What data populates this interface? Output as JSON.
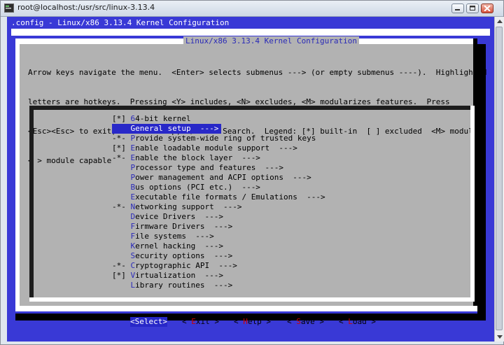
{
  "window": {
    "title": "root@localhost:/usr/src/linux-3.13.4",
    "buttons": [
      "minimize",
      "maximize",
      "close"
    ]
  },
  "terminal": {
    "config_title": ".config - Linux/x86 3.13.4 Kernel Configuration",
    "dialog_title": "Linux/x86 3.13.4 Kernel Configuration",
    "help_lines": [
      "Arrow keys navigate the menu.  <Enter> selects submenus ---> (or empty submenus ----).  Highlighted",
      "letters are hotkeys.  Pressing <Y> includes, <N> excludes, <M> modularizes features.  Press",
      "<Esc><Esc> to exit, <?> for Help, </> for Search.  Legend: [*] built-in  [ ] excluded  <M> module",
      "< > module capable"
    ],
    "menu": [
      {
        "prefix": "[*] ",
        "hotkey": "6",
        "rest": "4-bit kernel",
        "selected": false
      },
      {
        "prefix": "    ",
        "hotkey": "G",
        "rest": "eneral setup  --->",
        "selected": true
      },
      {
        "prefix": "-*- ",
        "hotkey": "P",
        "rest": "rovide system-wide ring of trusted keys",
        "selected": false
      },
      {
        "prefix": "[*] ",
        "hotkey": "E",
        "rest": "nable loadable module support  --->",
        "selected": false
      },
      {
        "prefix": "-*- ",
        "hotkey": "E",
        "rest": "nable the block layer  --->",
        "selected": false
      },
      {
        "prefix": "    ",
        "hotkey": "P",
        "rest": "rocessor type and features  --->",
        "selected": false
      },
      {
        "prefix": "    ",
        "hotkey": "P",
        "rest": "ower management and ACPI options  --->",
        "selected": false
      },
      {
        "prefix": "    ",
        "hotkey": "B",
        "rest": "us options (PCI etc.)  --->",
        "selected": false
      },
      {
        "prefix": "    ",
        "hotkey": "E",
        "rest": "xecutable file formats / Emulations  --->",
        "selected": false
      },
      {
        "prefix": "-*- ",
        "hotkey": "N",
        "rest": "etworking support  --->",
        "selected": false
      },
      {
        "prefix": "    ",
        "hotkey": "D",
        "rest": "evice Drivers  --->",
        "selected": false
      },
      {
        "prefix": "    ",
        "hotkey": "F",
        "rest": "irmware Drivers  --->",
        "selected": false
      },
      {
        "prefix": "    ",
        "hotkey": "F",
        "rest": "ile systems  --->",
        "selected": false
      },
      {
        "prefix": "    ",
        "hotkey": "K",
        "rest": "ernel hacking  --->",
        "selected": false
      },
      {
        "prefix": "    ",
        "hotkey": "S",
        "rest": "ecurity options  --->",
        "selected": false
      },
      {
        "prefix": "-*- ",
        "hotkey": "C",
        "rest": "ryptographic API  --->",
        "selected": false
      },
      {
        "prefix": "[*] ",
        "hotkey": "V",
        "rest": "irtualization  --->",
        "selected": false
      },
      {
        "prefix": "    ",
        "hotkey": "L",
        "rest": "ibrary routines  --->",
        "selected": false
      }
    ],
    "buttons": [
      {
        "text": "<Select>",
        "hotkey": "",
        "selected": true
      },
      {
        "text": "< Exit >",
        "hotkey": "E",
        "selected": false
      },
      {
        "text": "< Help >",
        "hotkey": "H",
        "selected": false
      },
      {
        "text": "< Save >",
        "hotkey": "S",
        "selected": false
      },
      {
        "text": "< Load >",
        "hotkey": "L",
        "selected": false
      }
    ]
  },
  "colors": {
    "terminal_bg": "#3939d6",
    "dialog_bg": "#b2b2b2",
    "highlight": "#2828c8",
    "hotkey": "#2a2ab8"
  }
}
